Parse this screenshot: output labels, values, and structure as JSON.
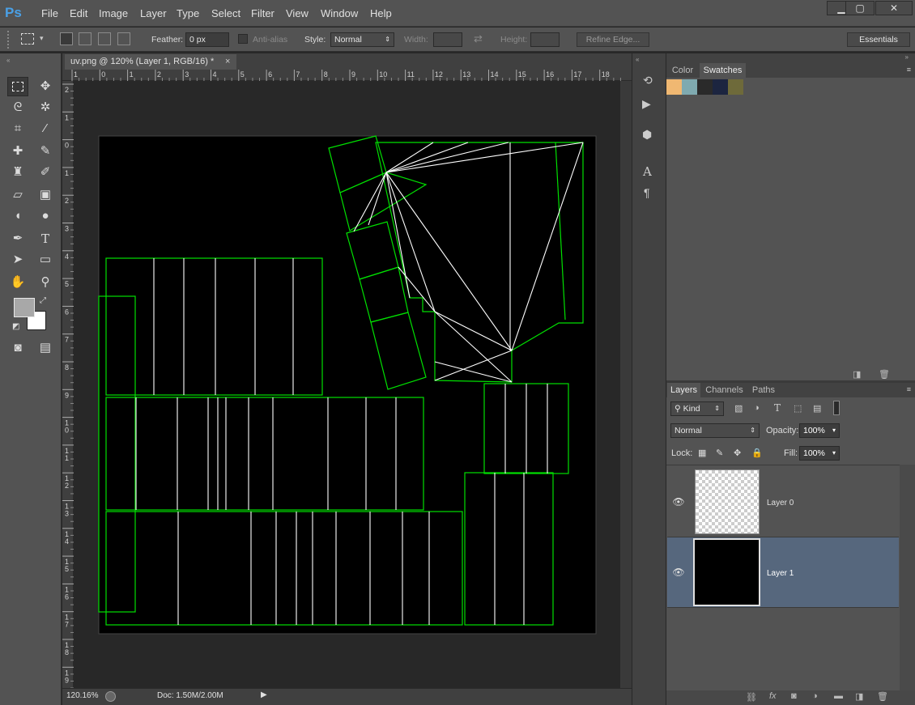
{
  "app": {
    "logo": "Ps"
  },
  "menu": [
    "File",
    "Edit",
    "Image",
    "Layer",
    "Type",
    "Select",
    "Filter",
    "View",
    "Window",
    "Help"
  ],
  "window_controls": {
    "minimize": "▁",
    "maximize": "▢",
    "close": "✕"
  },
  "options": {
    "feather_label": "Feather:",
    "feather_value": "0 px",
    "antialias_label": "Anti-alias",
    "style_label": "Style:",
    "style_value": "Normal",
    "width_label": "Width:",
    "height_label": "Height:",
    "refine_edge": "Refine Edge...",
    "workspace": "Essentials"
  },
  "document": {
    "tab_title": "uv.png @ 120% (Layer 1, RGB/16) *",
    "tab_close": "×"
  },
  "ruler_h": [
    "1",
    "0",
    "1",
    "2",
    "3",
    "4",
    "5",
    "6",
    "7",
    "8",
    "9",
    "10",
    "11",
    "12",
    "13",
    "14",
    "15",
    "16",
    "17",
    "18"
  ],
  "ruler_v": [
    "2",
    "1",
    "0",
    "1",
    "2",
    "3",
    "4",
    "5",
    "6",
    "7",
    "8",
    "9",
    "1\n0",
    "1\n1",
    "1\n2",
    "1\n3",
    "1\n4",
    "1\n5",
    "1\n6",
    "1\n7",
    "1\n8",
    "1\n9"
  ],
  "status": {
    "zoom": "120.16%",
    "doc": "Doc: 1.50M/2.00M"
  },
  "colors": {
    "uv_line": "#00e000",
    "uv_white": "#ffffff",
    "foreground": "#a8a8a8",
    "background": "#ffffff",
    "selected_layer": "#56677d"
  },
  "top_panel": {
    "tabs": [
      "Color",
      "Swatches"
    ],
    "active": "Swatches",
    "swatches": [
      "#f0b872",
      "#7faab0",
      "#2a2a2a",
      "#1c2540",
      "#6e6a3a"
    ]
  },
  "layers_panel": {
    "tabs": [
      "Layers",
      "Channels",
      "Paths"
    ],
    "kind_label": "Kind",
    "blend_mode": "Normal",
    "opacity_label": "Opacity:",
    "opacity_value": "100%",
    "lock_label": "Lock:",
    "fill_label": "Fill:",
    "fill_value": "100%",
    "layers": [
      {
        "name": "Layer 0",
        "selected": false
      },
      {
        "name": "Layer 1",
        "selected": true
      }
    ]
  }
}
